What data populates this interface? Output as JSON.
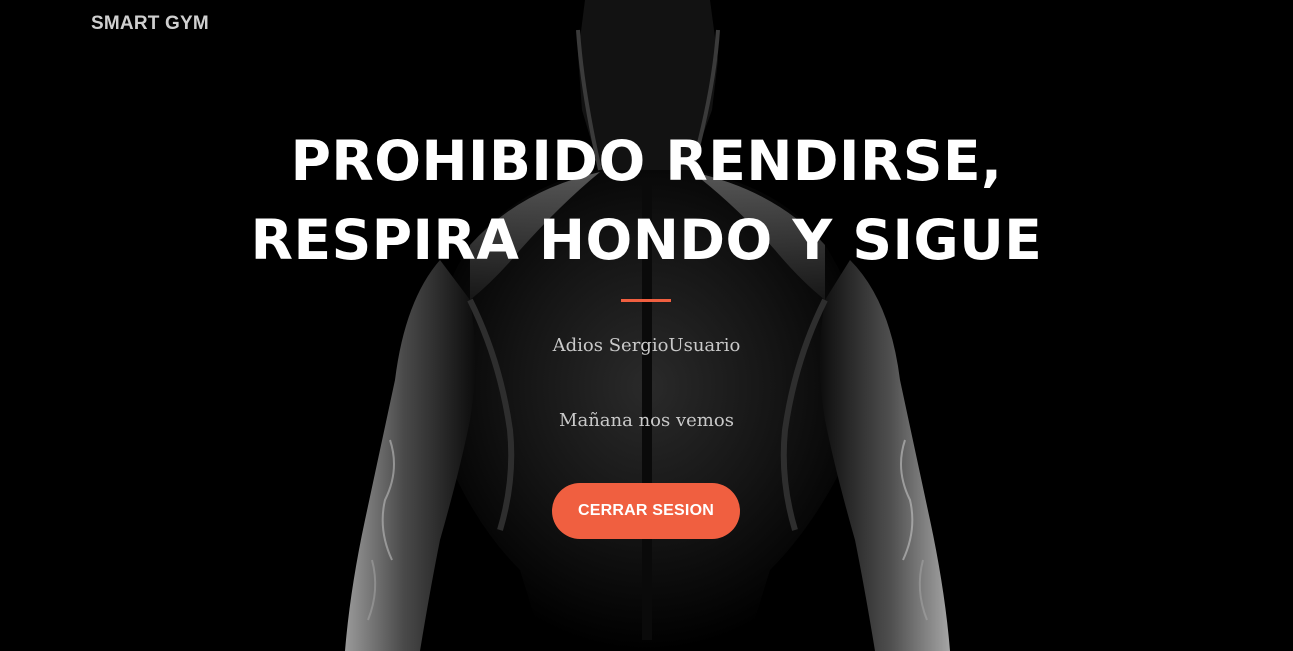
{
  "navbar": {
    "brand": "SMART GYM"
  },
  "hero": {
    "heading_line1": "PROHIBIDO RENDIRSE,",
    "heading_line2": "RESPIRA HONDO Y SIGUE",
    "farewell": "Adios SergioUsuario",
    "see_you": "Mañana nos vemos",
    "logout_label": "CERRAR SESION"
  },
  "colors": {
    "background": "#000000",
    "accent": "#f05f40",
    "heading": "#ffffff",
    "body_text": "#c9c9c9",
    "brand_text": "#cfcfcf"
  },
  "background_image": "muscular-man-back-silhouette"
}
